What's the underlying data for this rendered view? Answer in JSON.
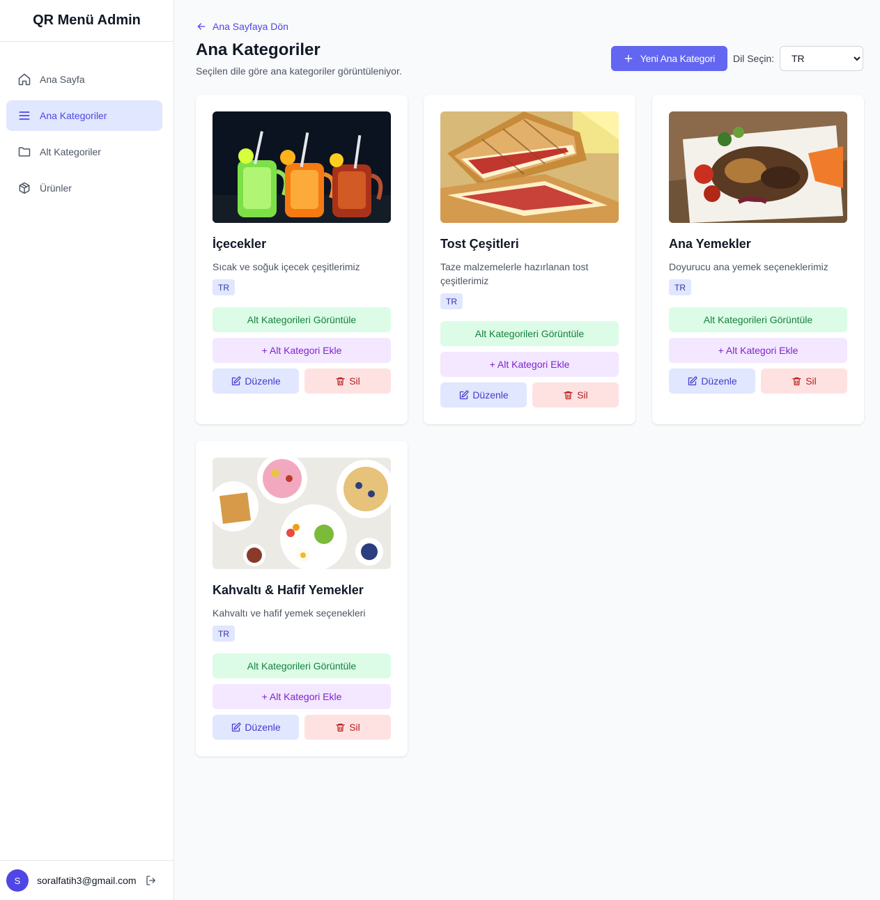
{
  "sidebar": {
    "brand": "QR Menü Admin",
    "items": [
      {
        "label": "Ana Sayfa",
        "icon": "home-icon",
        "active": false
      },
      {
        "label": "Ana Kategoriler",
        "icon": "menu-icon",
        "active": true
      },
      {
        "label": "Alt Kategoriler",
        "icon": "folder-icon",
        "active": false
      },
      {
        "label": "Ürünler",
        "icon": "box-icon",
        "active": false
      }
    ],
    "user": {
      "initial": "S",
      "email": "soralfatih3@gmail.com"
    }
  },
  "header": {
    "back_label": "Ana Sayfaya Dön",
    "title": "Ana Kategoriler",
    "subtitle": "Seçilen dile göre ana kategoriler görüntüleniyor.",
    "add_button": "Yeni Ana Kategori",
    "lang_label": "Dil Seçin:",
    "lang_value": "TR"
  },
  "buttons": {
    "view_sub": "Alt Kategorileri Görüntüle",
    "add_sub": "+ Alt Kategori Ekle",
    "edit": "Düzenle",
    "delete": "Sil"
  },
  "categories": [
    {
      "name": "İçecekler",
      "description": "Sıcak ve soğuk içecek çeşitlerimiz",
      "lang": "TR"
    },
    {
      "name": "Tost Çeşitleri",
      "description": "Taze malzemelerle hazırlanan tost çeşitlerimiz",
      "lang": "TR"
    },
    {
      "name": "Ana Yemekler",
      "description": "Doyurucu ana yemek seçeneklerimiz",
      "lang": "TR"
    },
    {
      "name": "Kahvaltı & Hafif Yemekler",
      "description": "Kahvaltı ve hafif yemek seçenekleri",
      "lang": "TR"
    }
  ],
  "colors": {
    "accent": "#6366f1",
    "active_nav_bg": "#e0e7ff",
    "view_bg": "#dcfce7",
    "add_sub_bg": "#f3e8ff",
    "delete_bg": "#fee2e2"
  }
}
